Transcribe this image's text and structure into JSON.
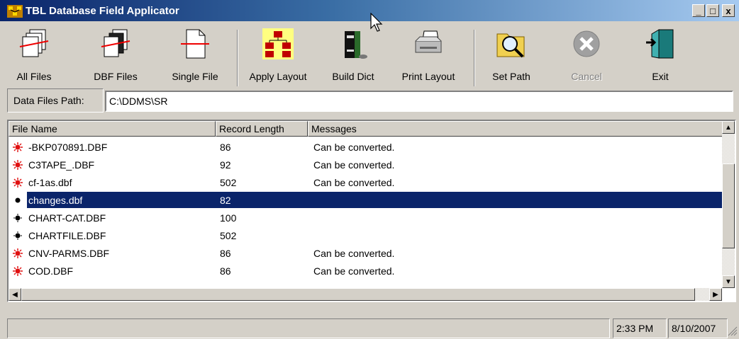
{
  "window": {
    "title": "TBL Database Field Applicator",
    "minimize": "_",
    "maximize": "□",
    "close": "x"
  },
  "toolbar": [
    {
      "label": "All Files",
      "icon": "all-files-icon",
      "enabled": true
    },
    {
      "label": "DBF Files",
      "icon": "dbf-files-icon",
      "enabled": true
    },
    {
      "label": "Single File",
      "icon": "single-file-icon",
      "enabled": true
    },
    {
      "label": "Apply Layout",
      "icon": "apply-layout-icon",
      "enabled": true
    },
    {
      "label": "Build Dict",
      "icon": "build-dict-icon",
      "enabled": true
    },
    {
      "label": "Print Layout",
      "icon": "printer-icon",
      "enabled": true
    },
    {
      "label": "Set Path",
      "icon": "folder-search-icon",
      "enabled": true
    },
    {
      "label": "Cancel",
      "icon": "cancel-icon",
      "enabled": false
    },
    {
      "label": "Exit",
      "icon": "exit-door-icon",
      "enabled": true
    }
  ],
  "path": {
    "label": "Data Files Path:",
    "value": "C:\\DDMS\\SR"
  },
  "list": {
    "columns": [
      "File Name",
      "Record Length",
      "Messages"
    ],
    "rows": [
      {
        "name": "-BKP070891.DBF",
        "length": "86",
        "message": "Can be converted.",
        "status": "red"
      },
      {
        "name": "C3TAPE_.DBF",
        "length": "92",
        "message": "Can be converted.",
        "status": "red"
      },
      {
        "name": "cf-1as.dbf",
        "length": "502",
        "message": "Can be converted.",
        "status": "red"
      },
      {
        "name": "changes.dbf",
        "length": "82",
        "message": "",
        "status": "black",
        "selected": true
      },
      {
        "name": "CHART-CAT.DBF",
        "length": "100",
        "message": "",
        "status": "black"
      },
      {
        "name": "CHARTFILE.DBF",
        "length": "502",
        "message": "",
        "status": "black"
      },
      {
        "name": "CNV-PARMS.DBF",
        "length": "86",
        "message": "Can be converted.",
        "status": "red"
      },
      {
        "name": "COD.DBF",
        "length": "86",
        "message": "Can be converted.",
        "status": "red"
      }
    ]
  },
  "status": {
    "message": "",
    "time": "2:33 PM",
    "date": "8/10/2007"
  },
  "colors": {
    "title_start": "#0a246a",
    "title_end": "#a6caf0",
    "selection": "#0a246a",
    "status_red": "#e01010"
  }
}
